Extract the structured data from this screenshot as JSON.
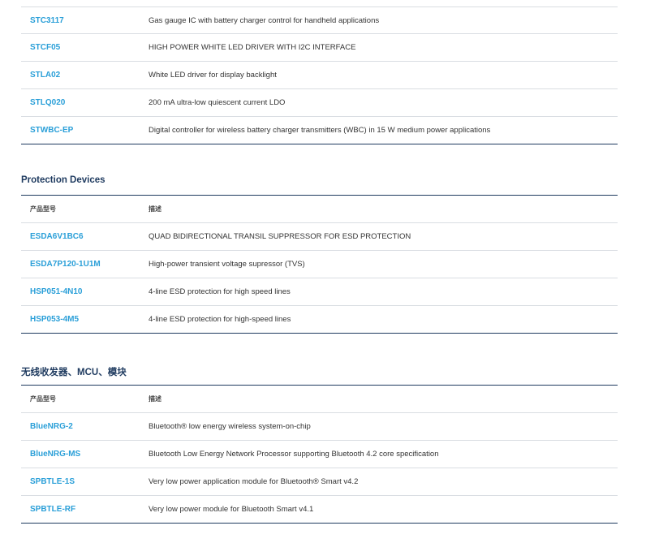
{
  "table1": {
    "rows": [
      {
        "part": "STC3117",
        "desc": "Gas gauge IC with battery charger control for handheld applications"
      },
      {
        "part": "STCF05",
        "desc": "HIGH POWER WHITE LED DRIVER WITH I2C INTERFACE"
      },
      {
        "part": "STLA02",
        "desc": "White LED driver for display backlight"
      },
      {
        "part": "STLQ020",
        "desc": "200 mA ultra-low quiescent current LDO"
      },
      {
        "part": "STWBC-EP",
        "desc": "Digital controller for wireless battery charger transmitters (WBC) in 15 W medium power applications"
      }
    ]
  },
  "section2": {
    "title": "Protection Devices",
    "col_part": "产品型号",
    "col_desc": "描述",
    "rows": [
      {
        "part": "ESDA6V1BC6",
        "desc": "QUAD BIDIRECTIONAL TRANSIL SUPPRESSOR FOR ESD PROTECTION"
      },
      {
        "part": "ESDA7P120-1U1M",
        "desc": "High-power transient voltage supressor (TVS)"
      },
      {
        "part": "HSP051-4N10",
        "desc": "4-line ESD protection for high speed lines"
      },
      {
        "part": "HSP053-4M5",
        "desc": "4-line ESD protection for high-speed lines"
      }
    ]
  },
  "section3": {
    "title": "无线收发器、MCU、模块",
    "col_part": "产品型号",
    "col_desc": "描述",
    "rows": [
      {
        "part": "BlueNRG-2",
        "desc": "Bluetooth® low energy wireless system-on-chip"
      },
      {
        "part": "BlueNRG-MS",
        "desc": "Bluetooth Low Energy Network Processor supporting Bluetooth 4.2 core specification"
      },
      {
        "part": "SPBTLE-1S",
        "desc": "Very low power application module for Bluetooth® Smart v4.2"
      },
      {
        "part": "SPBTLE-RF",
        "desc": "Very low power module for Bluetooth Smart v4.1"
      }
    ]
  }
}
